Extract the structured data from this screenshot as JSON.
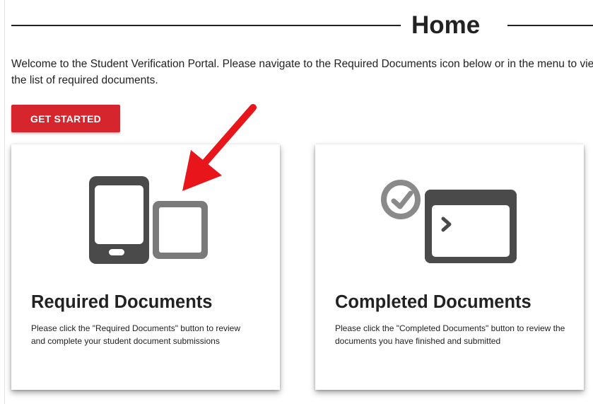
{
  "page": {
    "title": "Home",
    "welcome_text": "Welcome to the Student Verification Portal. Please navigate to the Required Documents icon below or in the menu to view the list of required documents."
  },
  "actions": {
    "get_started_label": "GET STARTED"
  },
  "cards": [
    {
      "title": "Required Documents",
      "description": "Please click the \"Required Documents\" button to review and complete your student document submissions",
      "icon": "mobile-and-tablet-icon"
    },
    {
      "title": "Completed Documents",
      "description": "Please click the \"Completed Documents\" button to review the documents you have finished and submitted",
      "icon": "clock-and-terminal-window-icon"
    }
  ],
  "annotation": {
    "icon": "red-arrow-icon",
    "color": "#e8161b"
  },
  "colors": {
    "accent": "#d6252c",
    "icon_dark": "#4a4a4a",
    "icon_mid": "#6e6e6e",
    "icon_light": "#8a8a8a"
  }
}
